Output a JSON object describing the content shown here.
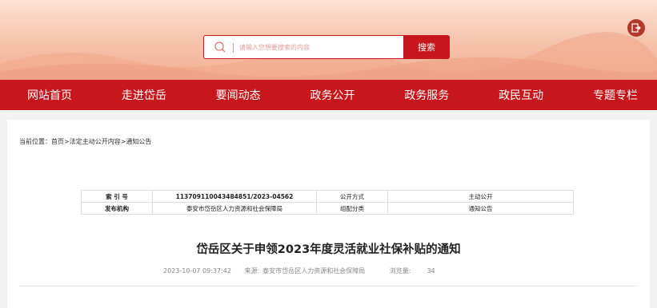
{
  "search": {
    "placeholder": "请输入您想要搜索的内容",
    "button_label": "搜索"
  },
  "nav": [
    "网站首页",
    "走进岱岳",
    "要闻动态",
    "政务公开",
    "政务服务",
    "政民互动",
    "专题专栏"
  ],
  "breadcrumb": "当前位置：首页>法定主动公开内容>通知公告",
  "meta": {
    "index_label": "索 引 号",
    "index_value": "113709110043484851/2023-04562",
    "method_label": "公开方式",
    "method_value": "主动公开",
    "org_label": "发布机构",
    "org_value": "泰安市岱岳区人力资源和社会保障局",
    "category_label": "组配分类",
    "category_value": "通知公告"
  },
  "article": {
    "title": "岱岳区关于申领2023年度灵活就业社保补贴的通知",
    "date": "2023-10-07 09:37:42",
    "source_label": "来源:",
    "source": "泰安市岱岳区人力资源和社会保障局",
    "views_label": "浏览量:",
    "views": "34"
  },
  "colors": {
    "brand_red": "#c8161d",
    "banner": "#f6c2aa"
  },
  "icons": {
    "search": "search-icon",
    "exit": "exit-icon"
  }
}
